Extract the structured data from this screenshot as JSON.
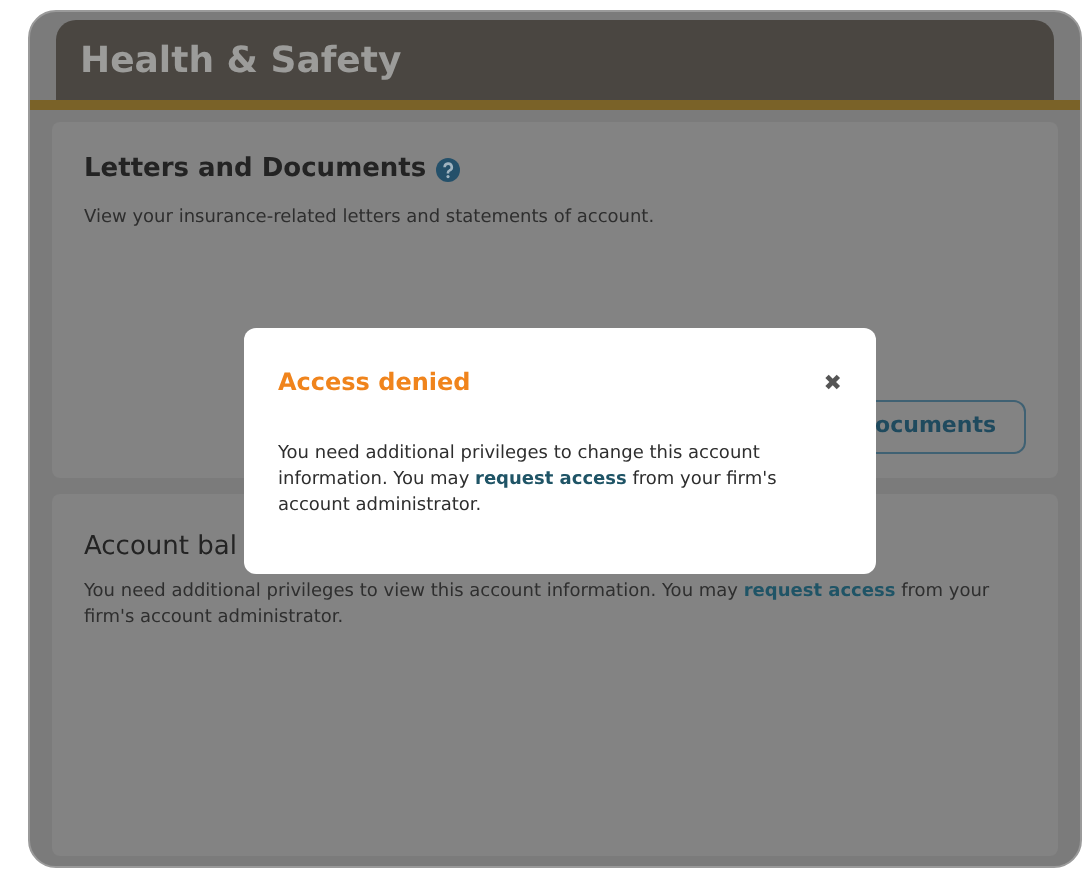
{
  "header": {
    "title": "Health & Safety"
  },
  "panels": [
    {
      "title": "Letters and Documents",
      "help": true,
      "text": "View your insurance-related letters and statements of account.",
      "button": "ocuments"
    },
    {
      "title": "Account bal",
      "help": false,
      "text": "You need additional privileges to view this account information. You may **request access** from your firm's account administrator."
    }
  ],
  "dialog": {
    "title": "Access denied",
    "close": "✖",
    "text": "You need additional privileges to change this account information. You may **request access** from your firm's account administrator."
  }
}
